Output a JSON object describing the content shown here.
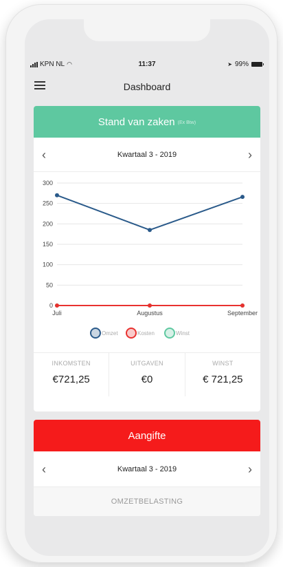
{
  "statusbar": {
    "carrier": "KPN NL",
    "time": "11:37",
    "battery": "99%"
  },
  "navbar": {
    "title": "Dashboard"
  },
  "overview": {
    "title": "Stand van zaken",
    "subtitle": "(Ex Btw)",
    "period": "Kwartaal 3 - 2019",
    "stats": [
      {
        "label": "INKOMSTEN",
        "value": "€721,25"
      },
      {
        "label": "UITGAVEN",
        "value": "€0"
      },
      {
        "label": "WINST",
        "value": "€ 721,25"
      }
    ]
  },
  "declaration": {
    "title": "Aangifte",
    "period": "Kwartaal 3 - 2019",
    "tax_label": "OMZETBELASTING"
  },
  "colors": {
    "green": "#5ec8a0",
    "red": "#f51b1b",
    "omzet": "#2a5a8a",
    "kosten": "#e8312f",
    "winst": "#5ec8a0"
  },
  "chart_data": {
    "type": "line",
    "categories": [
      "Juli",
      "Augustus",
      "September"
    ],
    "series": [
      {
        "name": "Omzet",
        "values": [
          270,
          185,
          266
        ],
        "color": "#2a5a8a"
      },
      {
        "name": "Kosten",
        "values": [
          0,
          0,
          0
        ],
        "color": "#e8312f"
      },
      {
        "name": "Winst",
        "values": [
          0,
          0,
          0
        ],
        "color": "#5ec8a0"
      }
    ],
    "ylim": [
      0,
      300
    ],
    "yticks": [
      0,
      50,
      100,
      150,
      200,
      250,
      300
    ],
    "grid": true,
    "legend": "bottom"
  }
}
